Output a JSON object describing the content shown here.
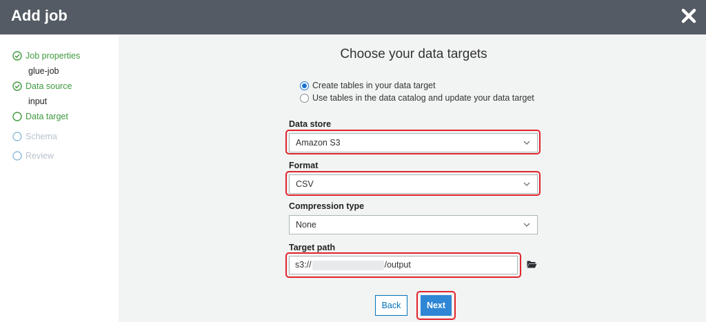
{
  "header": {
    "title": "Add job",
    "close_icon": "close-icon"
  },
  "sidebar": {
    "steps": [
      {
        "label": "Job properties",
        "status": "done",
        "sub": "glue-job"
      },
      {
        "label": "Data source",
        "status": "done",
        "sub": "input"
      },
      {
        "label": "Data target",
        "status": "current"
      },
      {
        "label": "Schema",
        "status": "pending"
      },
      {
        "label": "Review",
        "status": "pending"
      }
    ]
  },
  "main": {
    "title": "Choose your data targets",
    "options": [
      {
        "label": "Create tables in your data target",
        "checked": true
      },
      {
        "label": "Use tables in the data catalog and update your data target",
        "checked": false
      }
    ],
    "data_store": {
      "label": "Data store",
      "value": "Amazon S3"
    },
    "format": {
      "label": "Format",
      "value": "CSV"
    },
    "compression": {
      "label": "Compression type",
      "value": "None"
    },
    "target_path": {
      "label": "Target path",
      "prefix": "s3://",
      "suffix": "/output"
    },
    "buttons": {
      "back": "Back",
      "next": "Next"
    }
  },
  "colors": {
    "header_bg": "#545b64",
    "step_green": "#3f9a3f",
    "accent_blue": "#2e86d5",
    "highlight_red": "#e0232b"
  }
}
